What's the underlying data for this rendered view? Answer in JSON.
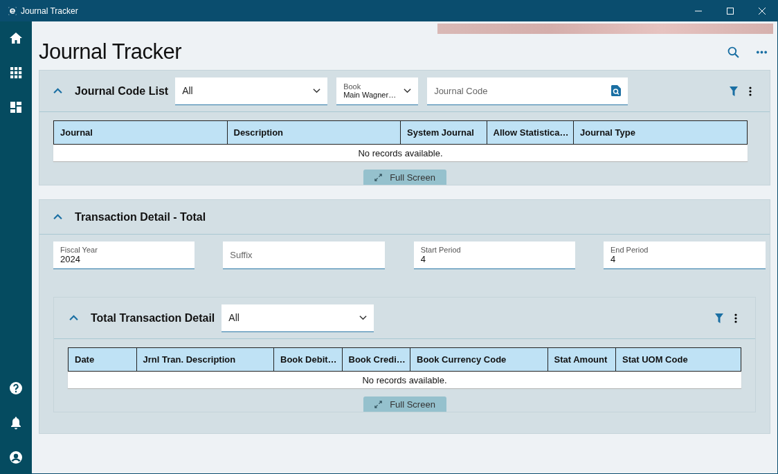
{
  "window": {
    "title": "Journal Tracker"
  },
  "sidebar": {
    "top_items": [
      {
        "kind": "home"
      },
      {
        "kind": "apps"
      },
      {
        "kind": "dashboard"
      }
    ],
    "bottom_items": [
      {
        "kind": "help"
      },
      {
        "kind": "notifications"
      },
      {
        "kind": "account"
      }
    ]
  },
  "page": {
    "title": "Journal Tracker"
  },
  "journal_code_list": {
    "title": "Journal Code List",
    "expanded": true,
    "filter": {
      "value": "All"
    },
    "book": {
      "label": "Book",
      "value": "Main Wagner…"
    },
    "journal_code": {
      "placeholder": "Journal Code"
    },
    "table": {
      "columns": [
        "Journal",
        "Description",
        "System Journal",
        "Allow Statistica…",
        "Journal Type"
      ],
      "empty_text": "No records available."
    },
    "full_screen": "Full Screen"
  },
  "transaction_detail_total": {
    "title": "Transaction Detail - Total",
    "expanded": true,
    "fields": [
      {
        "label": "Fiscal Year",
        "value": "2024"
      },
      {
        "placeholder": "Suffix"
      },
      {
        "label": "Start Period",
        "value": "4"
      },
      {
        "label": "End Period",
        "value": "4"
      }
    ],
    "total_transaction_detail": {
      "title": "Total Transaction Detail",
      "expanded": true,
      "filter": {
        "value": "All"
      },
      "table": {
        "columns": [
          "Date",
          "Jrnl Tran. Description",
          "Book Debit…",
          "Book Credi…",
          "Book Currency Code",
          "Stat Amount",
          "Stat UOM Code"
        ],
        "empty_text": "No records available."
      },
      "full_screen": "Full Screen"
    }
  }
}
